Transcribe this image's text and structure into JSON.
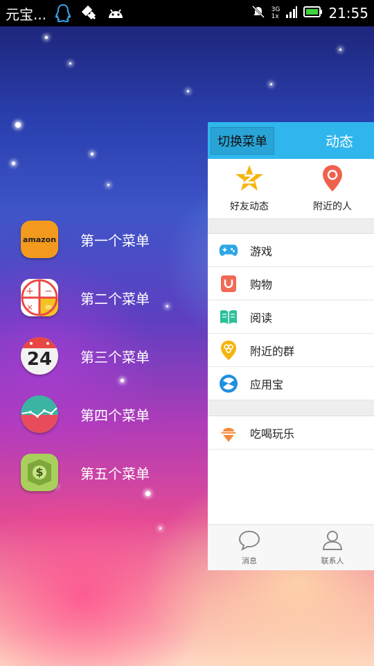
{
  "status_bar": {
    "app_title": "元宝...",
    "network_top": "3G",
    "network_bottom": "1x",
    "time": "21:55"
  },
  "menu": {
    "items": [
      {
        "label": "第一个菜单",
        "icon": "amazon-icon",
        "icon_text": "amazon"
      },
      {
        "label": "第二个菜单",
        "icon": "calculator-icon"
      },
      {
        "label": "第三个菜单",
        "icon": "calendar-icon",
        "icon_text": "24"
      },
      {
        "label": "第四个菜单",
        "icon": "chart-icon"
      },
      {
        "label": "第五个菜单",
        "icon": "money-icon",
        "icon_text": "$"
      }
    ]
  },
  "panel": {
    "switch_label": "切换菜单",
    "title": "动态",
    "quick": [
      {
        "label": "好友动态",
        "icon": "qzone-star-icon"
      },
      {
        "label": "附近的人",
        "icon": "location-pin-icon"
      }
    ],
    "list": [
      {
        "label": "游戏",
        "icon": "gamepad-icon"
      },
      {
        "label": "购物",
        "icon": "shopping-bag-icon"
      },
      {
        "label": "阅读",
        "icon": "book-icon"
      },
      {
        "label": "附近的群",
        "icon": "group-pin-icon"
      },
      {
        "label": "应用宝",
        "icon": "app-store-icon"
      }
    ],
    "list2": [
      {
        "label": "吃喝玩乐",
        "icon": "food-icon"
      }
    ],
    "bottom": [
      {
        "label": "消息",
        "icon": "message-bubble-icon"
      },
      {
        "label": "联系人",
        "icon": "contacts-icon"
      }
    ]
  },
  "colors": {
    "panel_header": "#2fb6ec",
    "switch_button": "#29a4d6",
    "amazon": "#f39a1e",
    "qzone": "#f5b50e",
    "pin": "#f0614d"
  }
}
